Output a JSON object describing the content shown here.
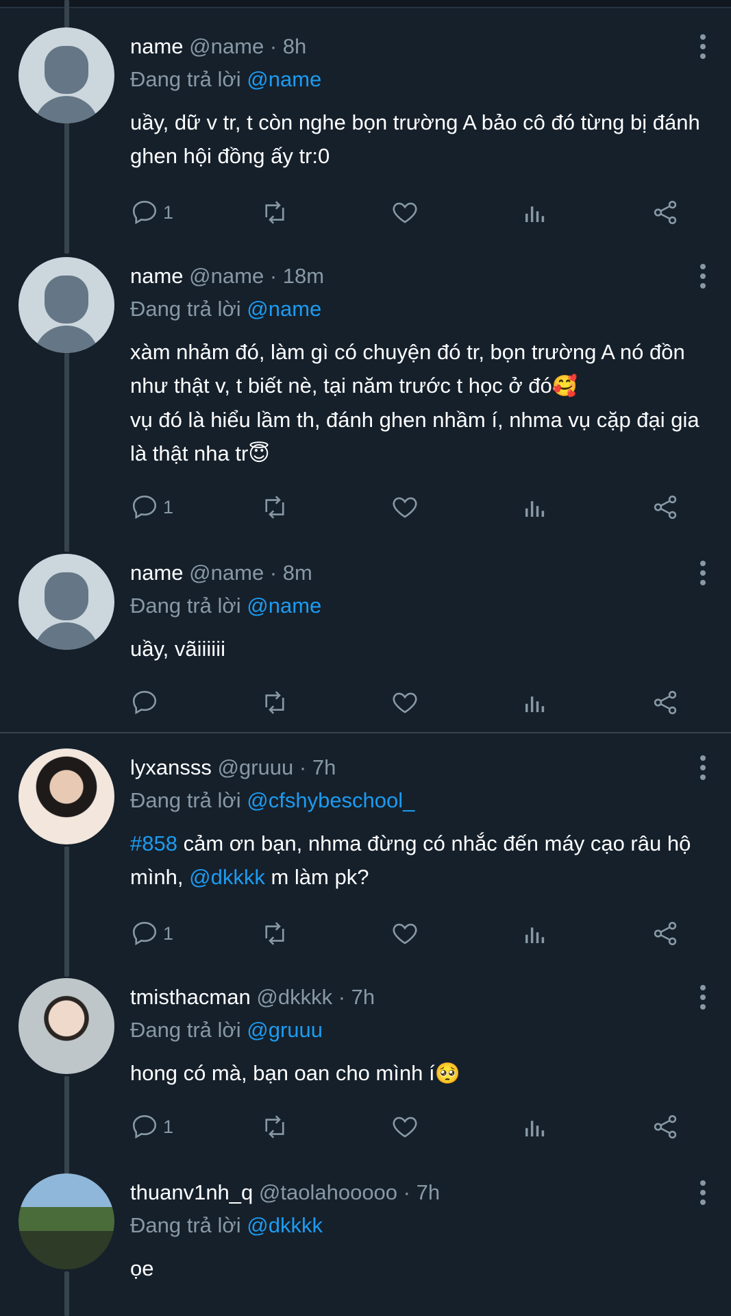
{
  "labels": {
    "replying_to": "Đang trả lời"
  },
  "colors": {
    "background": "#15202b",
    "accent": "#1d9bf0",
    "muted": "#8899a6",
    "divider": "#38444d"
  },
  "icons": [
    "reply-icon",
    "retweet-icon",
    "like-icon",
    "views-icon",
    "share-icon",
    "more-icon",
    "thread-line"
  ],
  "tweets": [
    {
      "name": "name",
      "handle": "@name",
      "sep": "·",
      "time": "8h",
      "reply_to": "@name",
      "text": "uầy, dữ v tr, t còn nghe bọn trường A bảo cô đó từng bị đánh ghen hội đồng ấy tr:0",
      "reply_count": "1"
    },
    {
      "name": "name",
      "handle": "@name",
      "sep": "·",
      "time": "18m",
      "reply_to": "@name",
      "text_line1": "xàm nhảm đó, làm gì có chuyện đó tr, bọn trường A nó đồn như thật v, t biết nè, tại năm trước t học ở đó",
      "emoji1": "🥰",
      "text_line2": "vụ đó là hiểu lầm th, đánh ghen nhầm í, nhma vụ cặp đại gia là thật nha tr",
      "emoji2": "😇",
      "reply_count": "1"
    },
    {
      "name": "name",
      "handle": "@name",
      "sep": "·",
      "time": "8m",
      "reply_to": "@name",
      "text": "uầy, vãiiiiii",
      "reply_count": ""
    },
    {
      "name": "lyxansss",
      "handle": "@gruuu",
      "sep": "·",
      "time": "7h",
      "reply_to": "@cfshybeschool_",
      "hashtag": "#858",
      "text_a": " cảm ơn bạn, nhma đừng có nhắc đến máy cạo râu hộ mình, ",
      "mention": "@dkkkk",
      "text_b": " m làm pk?",
      "reply_count": "1"
    },
    {
      "name": "tmisthacman",
      "handle": "@dkkkk",
      "sep": "·",
      "time": "7h",
      "reply_to": "@gruuu",
      "text": "hong có mà, bạn oan cho mình í",
      "emoji": "🥺",
      "reply_count": "1"
    },
    {
      "name": "thuanv1nh_q",
      "handle": "@taolahooooo",
      "sep": "·",
      "time": "7h",
      "reply_to": "@dkkkk",
      "text": "ọe"
    }
  ]
}
